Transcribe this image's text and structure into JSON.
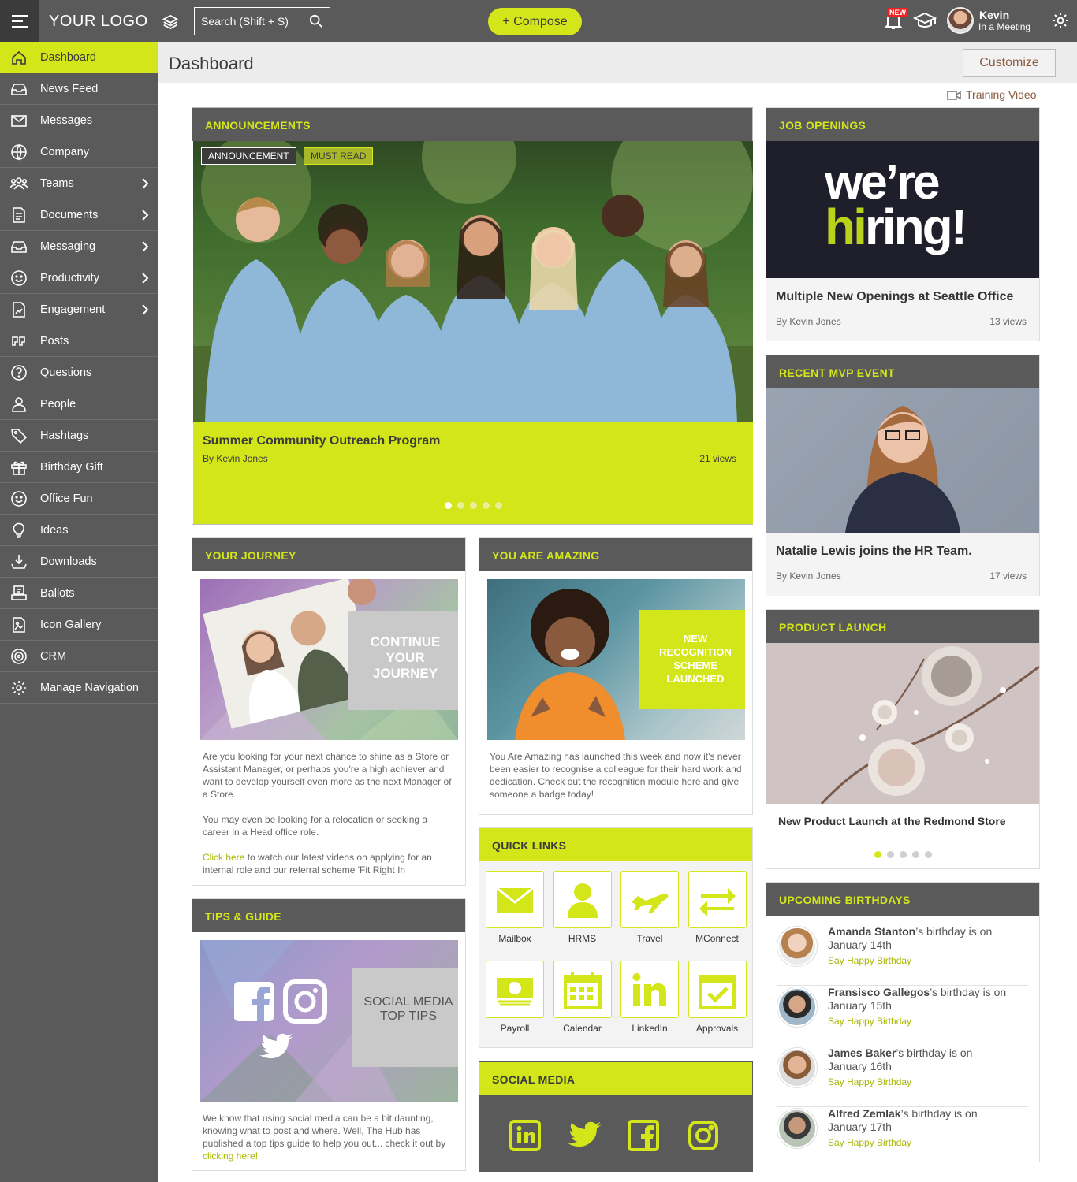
{
  "brand": {
    "logo_text": "YOUR LOGO",
    "accent": "#d3e619",
    "dark": "#5a5a5a"
  },
  "topbar": {
    "search_placeholder": "Search (Shift + S)",
    "compose_label": "+ Compose",
    "new_badge": "NEW",
    "user_name": "Kevin",
    "user_status": "In a Meeting"
  },
  "sidebar": {
    "items": [
      {
        "label": "Dashboard",
        "icon": "home-icon",
        "active": true
      },
      {
        "label": "News Feed",
        "icon": "inbox-icon"
      },
      {
        "label": "Messages",
        "icon": "envelope-icon"
      },
      {
        "label": "Company",
        "icon": "globe-icon"
      },
      {
        "label": "Teams",
        "icon": "team-icon",
        "has_children": true
      },
      {
        "label": "Documents",
        "icon": "document-icon",
        "has_children": true
      },
      {
        "label": "Messaging",
        "icon": "inbox-icon",
        "has_children": true
      },
      {
        "label": "Productivity",
        "icon": "smile-icon",
        "has_children": true
      },
      {
        "label": "Engagement",
        "icon": "chart-doc-icon",
        "has_children": true
      },
      {
        "label": "Posts",
        "icon": "quote-icon"
      },
      {
        "label": "Questions",
        "icon": "question-icon"
      },
      {
        "label": "People",
        "icon": "user-icon"
      },
      {
        "label": "Hashtags",
        "icon": "tag-icon"
      },
      {
        "label": "Birthday Gift",
        "icon": "gift-icon"
      },
      {
        "label": "Office Fun",
        "icon": "smile-icon"
      },
      {
        "label": "Ideas",
        "icon": "bulb-icon"
      },
      {
        "label": "Downloads",
        "icon": "download-icon"
      },
      {
        "label": "Ballots",
        "icon": "ballot-icon"
      },
      {
        "label": "Icon Gallery",
        "icon": "image-doc-icon"
      },
      {
        "label": "CRM",
        "icon": "target-icon"
      },
      {
        "label": "Manage Navigation",
        "icon": "gear-icon"
      }
    ]
  },
  "header": {
    "title": "Dashboard",
    "customize_label": "Customize",
    "training_label": "Training Video"
  },
  "announcements": {
    "heading": "ANNOUNCEMENTS",
    "tags": [
      "ANNOUNCEMENT",
      "MUST READ"
    ],
    "title": "Summer Community Outreach Program",
    "byline": "By Kevin Jones",
    "views": "21 views",
    "slide_count": 5,
    "active_slide": 0
  },
  "journey": {
    "heading": "YOUR JOURNEY",
    "overlay_text": "CONTINUE YOUR JOURNEY",
    "p1": "Are you looking for your next chance to shine as a Store or Assistant Manager, or perhaps you're a high achiever and want to develop yourself even more as the next Manager of a Store.",
    "p2": "You may even be looking for a relocation or seeking a career in a Head office role.",
    "p3_link": "Click here",
    "p3_rest": " to watch our latest videos on applying for an internal role and our referral scheme 'Fit Right In"
  },
  "amazing": {
    "heading": "YOU ARE AMAZING",
    "overlay_text": "NEW RECOGNITION SCHEME LAUNCHED",
    "p1": "You Are Amazing has launched this week and now it's never been easier to recognise a colleague for their hard work and dedication. Check out the recognition module here and give someone a badge today!"
  },
  "tips": {
    "heading": "TIPS & GUIDE",
    "overlay_text": "SOCIAL MEDIA TOP TIPS",
    "p1": "We know that using social media can be a bit daunting, knowing what to post and where. Well, The Hub has published a top tips guide to help you out... check it out by ",
    "p1_link": "clicking here!"
  },
  "quick_links": {
    "heading": "QUICK LINKS",
    "items": [
      {
        "label": "Mailbox",
        "icon": "mail-icon"
      },
      {
        "label": "HRMS",
        "icon": "person-icon"
      },
      {
        "label": "Travel",
        "icon": "plane-icon"
      },
      {
        "label": "MConnect",
        "icon": "arrows-icon"
      },
      {
        "label": "Payroll",
        "icon": "money-icon"
      },
      {
        "label": "Calendar",
        "icon": "calendar-icon"
      },
      {
        "label": "LinkedIn",
        "icon": "linkedin-icon"
      },
      {
        "label": "Approvals",
        "icon": "approval-icon"
      }
    ]
  },
  "social": {
    "heading": "SOCIAL MEDIA",
    "icons": [
      "linkedin-icon",
      "twitter-icon",
      "facebook-icon",
      "instagram-icon"
    ]
  },
  "jobs": {
    "heading": "JOB OPENINGS",
    "banner_line1": "we’re",
    "banner_line2a": "hi",
    "banner_line2b": "ring!",
    "title": "Multiple New Openings at Seattle Office",
    "byline": "By Kevin Jones",
    "views": "13 views"
  },
  "mvp": {
    "heading": "RECENT MVP EVENT",
    "title": "Natalie Lewis joins the HR Team.",
    "byline": "By Kevin Jones",
    "views": "17 views"
  },
  "product": {
    "heading": "PRODUCT LAUNCH",
    "title": "New Product Launch at the Redmond Store",
    "slide_count": 5,
    "active_slide": 0
  },
  "birthdays": {
    "heading": "UPCOMING BIRTHDAYS",
    "suffix": "’s birthday is on",
    "cta": "Say Happy Birthday",
    "items": [
      {
        "name": "Amanda Stanton",
        "date": "January 14th"
      },
      {
        "name": "Fransisco Gallegos",
        "date": "January 15th"
      },
      {
        "name": "James Baker",
        "date": "January 16th"
      },
      {
        "name": "Alfred Zemlak",
        "date": "January 17th"
      }
    ]
  }
}
